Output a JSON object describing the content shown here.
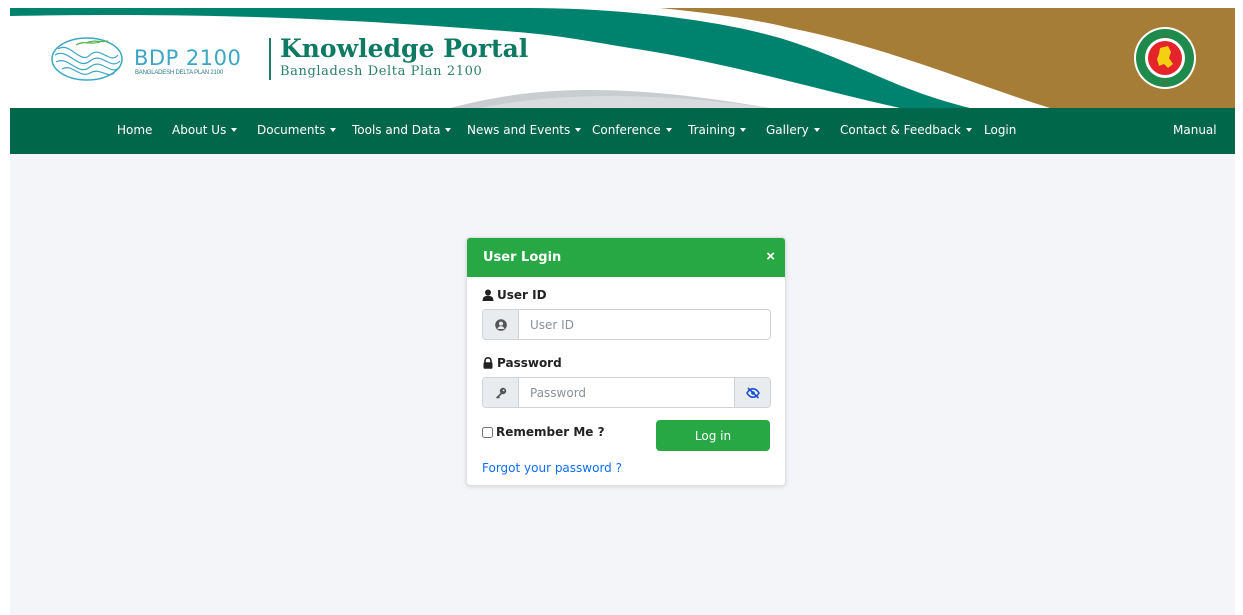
{
  "header": {
    "bdp_title": "BDP 2100",
    "bdp_subtitle": "BANGLADESH DELTA PLAN 2100",
    "portal_title": "Knowledge Portal",
    "portal_subtitle": "Bangladesh Delta Plan 2100"
  },
  "colors": {
    "navbar": "#00674b",
    "banner_teal": "#00836e",
    "banner_gold": "#a67d36",
    "card_header": "#28a745",
    "link": "#0d6efd"
  },
  "nav": {
    "items": [
      {
        "label": "Home",
        "dropdown": false
      },
      {
        "label": "About Us",
        "dropdown": true
      },
      {
        "label": "Documents",
        "dropdown": true
      },
      {
        "label": "Tools and Data",
        "dropdown": true
      },
      {
        "label": "News and Events",
        "dropdown": true
      },
      {
        "label": "Conference",
        "dropdown": true
      },
      {
        "label": "Training",
        "dropdown": true
      },
      {
        "label": "Gallery",
        "dropdown": true
      },
      {
        "label": "Contact & Feedback",
        "dropdown": true
      },
      {
        "label": "Login",
        "dropdown": false
      }
    ],
    "right": "Manual"
  },
  "login": {
    "title": "User Login",
    "close": "×",
    "userid_label": "User ID",
    "userid_placeholder": "User ID",
    "userid_value": "",
    "password_label": "Password",
    "password_placeholder": "Password",
    "password_value": "",
    "remember_label": "Remember Me ?",
    "remember_checked": false,
    "submit_label": "Log in",
    "forgot_label": "Forgot your password ?"
  },
  "icons": {
    "user": "user-icon",
    "lock": "lock-icon",
    "user_circle": "user-circle-icon",
    "key": "key-icon",
    "eye_slash": "eye-slash-icon"
  }
}
